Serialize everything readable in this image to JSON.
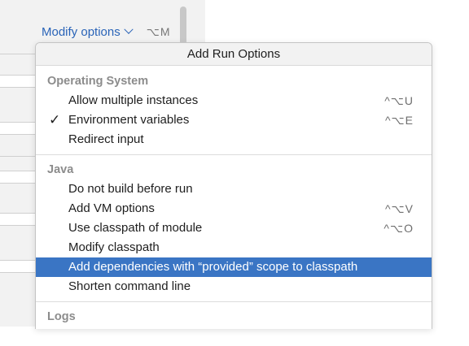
{
  "modify_options": {
    "label": "Modify options",
    "shortcut": "⌥M"
  },
  "popup": {
    "title": "Add Run Options",
    "groups": [
      {
        "header": "Operating System",
        "items": [
          {
            "label": "Allow multiple instances",
            "shortcut": "^⌥U",
            "checked": false
          },
          {
            "label": "Environment variables",
            "shortcut": "^⌥E",
            "checked": true,
            "check_glyph": "✓"
          },
          {
            "label": "Redirect input",
            "shortcut": "",
            "checked": false
          }
        ]
      },
      {
        "header": "Java",
        "items": [
          {
            "label": "Do not build before run",
            "shortcut": ""
          },
          {
            "label": "Add VM options",
            "shortcut": "^⌥V"
          },
          {
            "label": "Use classpath of module",
            "shortcut": "^⌥O"
          },
          {
            "label": "Modify classpath",
            "shortcut": ""
          },
          {
            "label": "Add dependencies with “provided” scope to classpath",
            "shortcut": "",
            "selected": true
          },
          {
            "label": "Shorten command line",
            "shortcut": ""
          }
        ]
      },
      {
        "header": "Logs",
        "items": []
      }
    ]
  },
  "colors": {
    "accent": "#2a64b8",
    "selection": "#3a75c4"
  }
}
